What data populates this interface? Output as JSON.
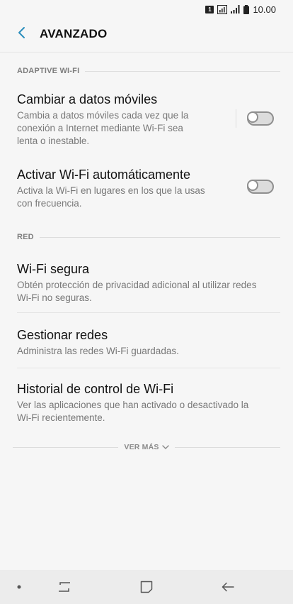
{
  "status_bar": {
    "sim_label": "1",
    "time": "10.00",
    "icons": [
      "sim-icon",
      "network-icon",
      "signal-icon",
      "battery-icon"
    ]
  },
  "header": {
    "title": "AVANZADO",
    "back_icon": "chevron-left-icon"
  },
  "sections": {
    "adaptive": {
      "label": "ADAPTIVE WI-FI",
      "items": [
        {
          "title": "Cambiar a datos móviles",
          "subtitle": "Cambia a datos móviles cada vez que la\nconexión a Internet mediante Wi-Fi sea\nlenta o inestable.",
          "toggle": "off"
        },
        {
          "title": "Activar Wi-Fi automáticamente",
          "subtitle": "Activa la Wi-Fi en lugares en los que la usas\ncon frecuencia.",
          "toggle": "off"
        }
      ]
    },
    "red": {
      "label": "RED",
      "items": [
        {
          "title": "Wi-Fi segura",
          "subtitle": "Obtén protección de privacidad adicional al utilizar redes\nWi-Fi no seguras."
        },
        {
          "title": "Gestionar redes",
          "subtitle": "Administra las redes Wi-Fi guardadas."
        },
        {
          "title": "Historial de control de Wi-Fi",
          "subtitle": "Ver las aplicaciones que han activado o desactivado la\nWi-Fi recientemente."
        }
      ]
    }
  },
  "see_more": {
    "label": "VER MÁS",
    "icon": "chevron-down-icon"
  },
  "nav_bar": {
    "icons": [
      "dot-indicator",
      "recent-apps-icon",
      "home-icon",
      "back-arrow-icon"
    ]
  },
  "colors": {
    "accent": "#2d8fbd",
    "background": "#f6f6f6",
    "navbar": "#ececec"
  }
}
